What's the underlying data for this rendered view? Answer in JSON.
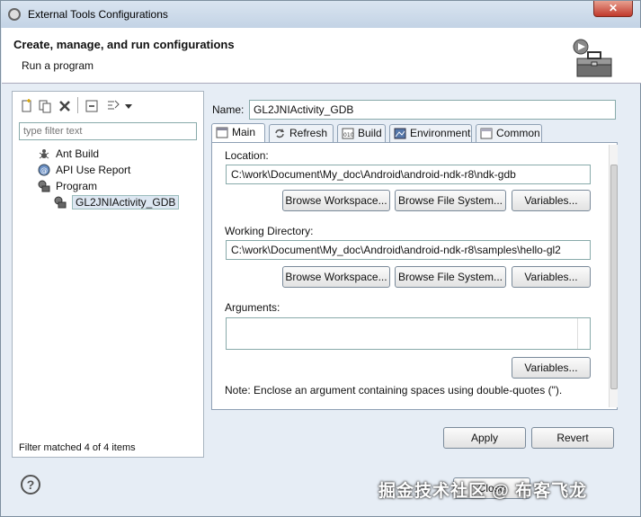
{
  "window": {
    "title": "External Tools Configurations"
  },
  "banner": {
    "heading": "Create, manage, and run configurations",
    "subheading": "Run a program"
  },
  "left": {
    "filter_placeholder": "type filter text",
    "tree": [
      {
        "label": "Ant Build",
        "icon": "ant-icon"
      },
      {
        "label": "API Use Report",
        "icon": "api-report-icon"
      },
      {
        "label": "Program",
        "icon": "program-icon"
      },
      {
        "label": "GL2JNIActivity_GDB",
        "icon": "program-config-icon",
        "selected": true
      }
    ],
    "status": "Filter matched 4 of 4 items"
  },
  "right": {
    "name_label": "Name:",
    "name_value": "GL2JNIActivity_GDB",
    "tabs": [
      {
        "label": "Main",
        "active": true
      },
      {
        "label": "Refresh"
      },
      {
        "label": "Build"
      },
      {
        "label": "Environment"
      },
      {
        "label": "Common"
      }
    ],
    "location_label": "Location:",
    "location_value": "C:\\work\\Document\\My_doc\\Android\\android-ndk-r8\\ndk-gdb",
    "workdir_label": "Working Directory:",
    "workdir_value": "C:\\work\\Document\\My_doc\\Android\\android-ndk-r8\\samples\\hello-gl2",
    "arguments_label": "Arguments:",
    "browse_workspace": "Browse Workspace...",
    "browse_filesystem": "Browse File System...",
    "variables": "Variables...",
    "note": "Note: Enclose an argument containing spaces using double-quotes (\")."
  },
  "footer": {
    "apply": "Apply",
    "revert": "Revert",
    "help": "?",
    "close": "Close"
  },
  "watermark": "掘金技术社区 @ 布客飞龙",
  "colors": {
    "frame": "#e6edf5",
    "accent": "#c0392b"
  }
}
